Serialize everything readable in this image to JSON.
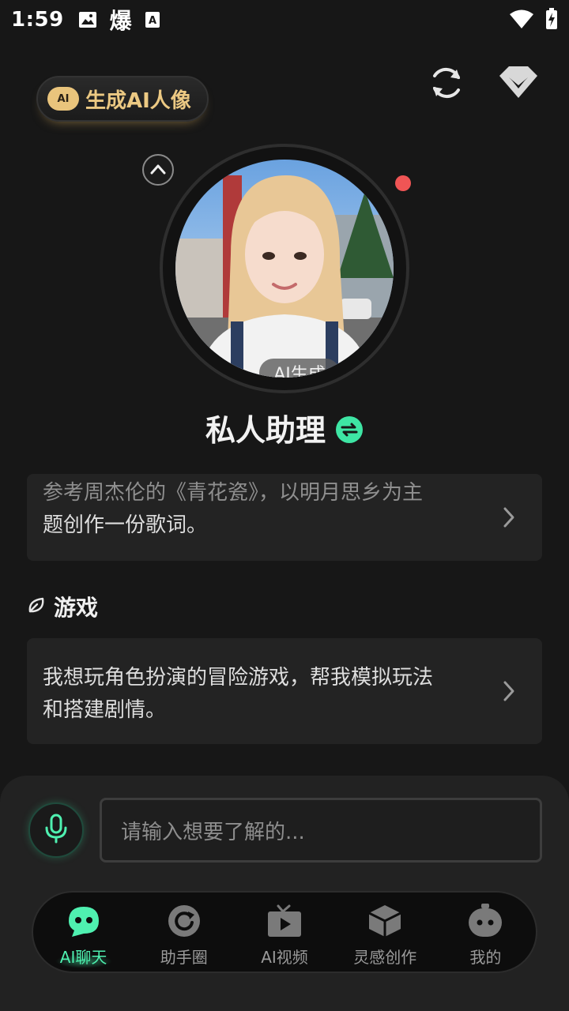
{
  "status_bar": {
    "time": "1:59",
    "icons": [
      "gallery-icon",
      "explode-char-icon",
      "font-icon",
      "wifi-icon",
      "battery-charging-icon"
    ],
    "explode_char": "爆"
  },
  "header": {
    "gen_portrait_badge": "AI",
    "gen_portrait_label": "生成AI人像",
    "refresh_icon": "refresh-icon",
    "vip_icon": "diamond-icon"
  },
  "assistant": {
    "ai_tag": "AI生成",
    "name": "私人助理",
    "online_color": "#f05555"
  },
  "prompts": {
    "card1_line1": "参考周杰伦的《青花瓷》，以明月思乡为主",
    "card1_line2": "题创作一份歌词。",
    "section_title": "游戏",
    "card2_line1": "我想玩角色扮演的冒险游戏，帮我模拟玩法",
    "card2_line2": "和搭建剧情。"
  },
  "composer": {
    "placeholder": "请输入想要了解的..."
  },
  "tabs": [
    {
      "label": "AI聊天",
      "icon": "chat-bot-icon",
      "active": true
    },
    {
      "label": "助手圈",
      "icon": "circle-icon",
      "active": false
    },
    {
      "label": "AI视频",
      "icon": "video-icon",
      "active": false
    },
    {
      "label": "灵感创作",
      "icon": "cube-icon",
      "active": false
    },
    {
      "label": "我的",
      "icon": "profile-bot-icon",
      "active": false
    }
  ],
  "colors": {
    "accent": "#4ff0b0",
    "gold": "#ecc983",
    "background": "#171717"
  }
}
